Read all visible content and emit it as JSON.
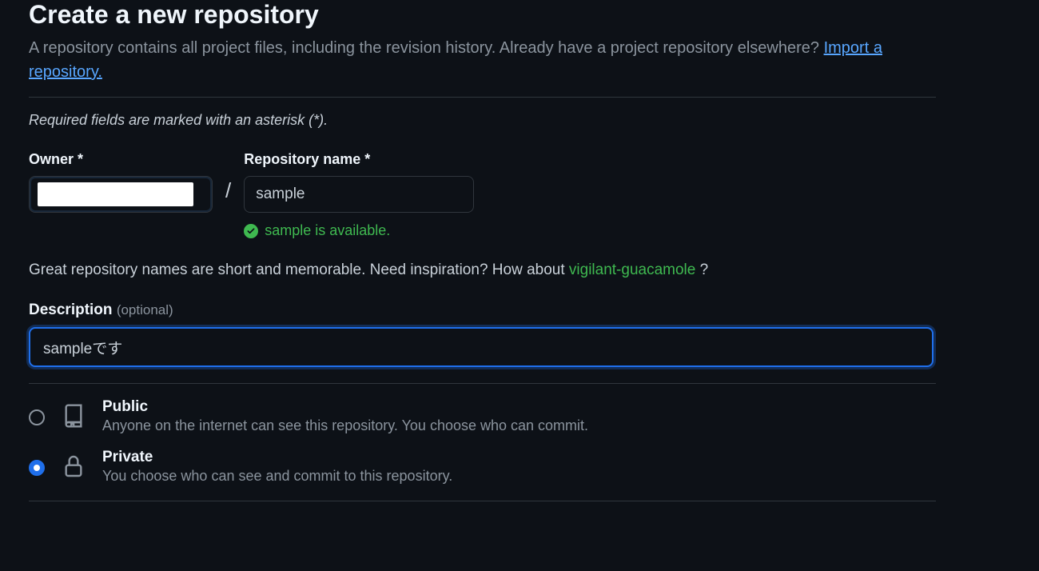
{
  "header": {
    "title": "Create a new repository",
    "subtitle_prefix": "A repository contains all project files, including the revision history. Already have a project repository elsewhere? ",
    "import_link": "Import a repository."
  },
  "required_note": "Required fields are marked with an asterisk (*).",
  "owner": {
    "label": "Owner *"
  },
  "repo_name": {
    "label": "Repository name *",
    "value": "sample",
    "availability": "sample is available."
  },
  "hint": {
    "text_before": "Great repository names are short and memorable. Need inspiration? How about ",
    "suggestion": "vigilant-guacamole",
    "text_after": " ?"
  },
  "description": {
    "label": "Description ",
    "optional": "(optional)",
    "value": "sampleです"
  },
  "visibility": {
    "public": {
      "title": "Public",
      "desc": "Anyone on the internet can see this repository. You choose who can commit.",
      "selected": false
    },
    "private": {
      "title": "Private",
      "desc": "You choose who can see and commit to this repository.",
      "selected": true
    }
  }
}
